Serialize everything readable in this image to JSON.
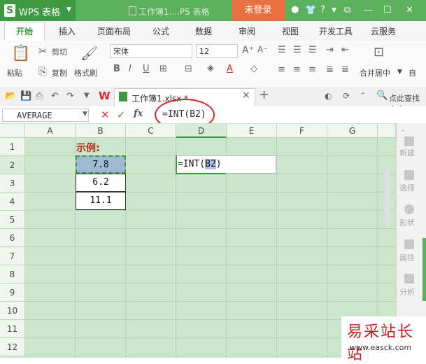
{
  "title_bar": {
    "app_name": "WPS 表格",
    "doc_title": "工作簿1....PS 表格",
    "login_label": "未登录"
  },
  "tabs": [
    "开始",
    "插入",
    "页面布局",
    "公式",
    "数据",
    "审阅",
    "视图",
    "开发工具",
    "云服务"
  ],
  "ribbon": {
    "paste": "粘贴",
    "cut": "剪切",
    "copy": "复制",
    "format_painter": "格式刷",
    "font_name": "宋体",
    "font_size": "12",
    "merge_center": "合并居中",
    "auto_label": "自"
  },
  "doc_tab": {
    "label": "工作簿1.xlsx *",
    "search_cmd": "点此查找命令"
  },
  "formula_bar": {
    "name_box": "AVERAGE",
    "fx": "fx",
    "formula": "=INT(B2)"
  },
  "columns": [
    "A",
    "B",
    "C",
    "D",
    "E",
    "F",
    "G"
  ],
  "rows": [
    "1",
    "2",
    "3",
    "4",
    "5",
    "6",
    "7",
    "8",
    "9",
    "10",
    "11",
    "12"
  ],
  "cells": {
    "B1": "示例:",
    "B2": "7.8",
    "B3": "6.2",
    "B4": "11.1",
    "D2_prefix": "=INT(",
    "D2_ref": "B2",
    "D2_suffix": ")"
  },
  "right_panel": [
    "新建",
    "选择",
    "形状",
    "属性",
    "分析"
  ],
  "watermark": {
    "text": "易采站长站",
    "url": "www.easck.com"
  },
  "colors": {
    "title_green": "#5bb05c",
    "login_orange": "#e9713f",
    "grid_green": "#cbe6cb",
    "highlight_red": "#d82020",
    "example_red": "#cc1a1a"
  }
}
